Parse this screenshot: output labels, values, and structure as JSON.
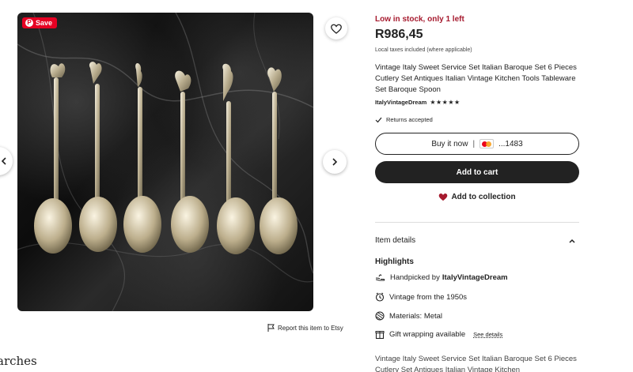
{
  "gallery": {
    "save_badge": "Save",
    "pin_glyph": "P",
    "report_label": "Report this item to Etsy",
    "searches_heading": "arches"
  },
  "listing": {
    "stock_text": "Low in stock, only 1 left",
    "price": "R986,45",
    "tax_note": "Local taxes included (where applicable)",
    "title": "Vintage Italy Sweet Service Set Italian Baroque Set 6 Pieces Cutlery Set Antiques Italian Vintage Kitchen Tools Tableware Set Baroque Spoon",
    "shop_name": "ItalyVintageDream",
    "stars": "★★★★★",
    "returns": "Returns accepted"
  },
  "actions": {
    "buy_now": "Buy it now",
    "separator": "|",
    "card_number": "...1483",
    "add_to_cart": "Add to cart",
    "add_to_collection": "Add to collection"
  },
  "details": {
    "item_details_label": "Item details",
    "highlights_label": "Highlights",
    "handpicked_prefix": "Handpicked by",
    "handpicked_shop": "ItalyVintageDream",
    "vintage": "Vintage from the 1950s",
    "materials": "Materials: Metal",
    "gift_wrapping": "Gift wrapping available",
    "see_details": "See details"
  },
  "description": {
    "text": "Vintage Italy Sweet Service Set Italian Baroque Set 6 Pieces Cutlery Set Antiques Italian Vintage Kitchen"
  },
  "colors": {
    "stock_red": "#a61a2e",
    "primary_dark": "#222222",
    "heart_red": "#a61a2e",
    "pinterest_red": "#e60023"
  },
  "icons": [
    "chevron-left-icon",
    "heart-outline-icon",
    "chevron-right-icon",
    "flag-icon",
    "checkmark-icon",
    "mastercard-icon",
    "heart-filled-icon",
    "chevron-up-icon",
    "hand-icon",
    "clock-icon",
    "material-icon",
    "gift-icon"
  ]
}
